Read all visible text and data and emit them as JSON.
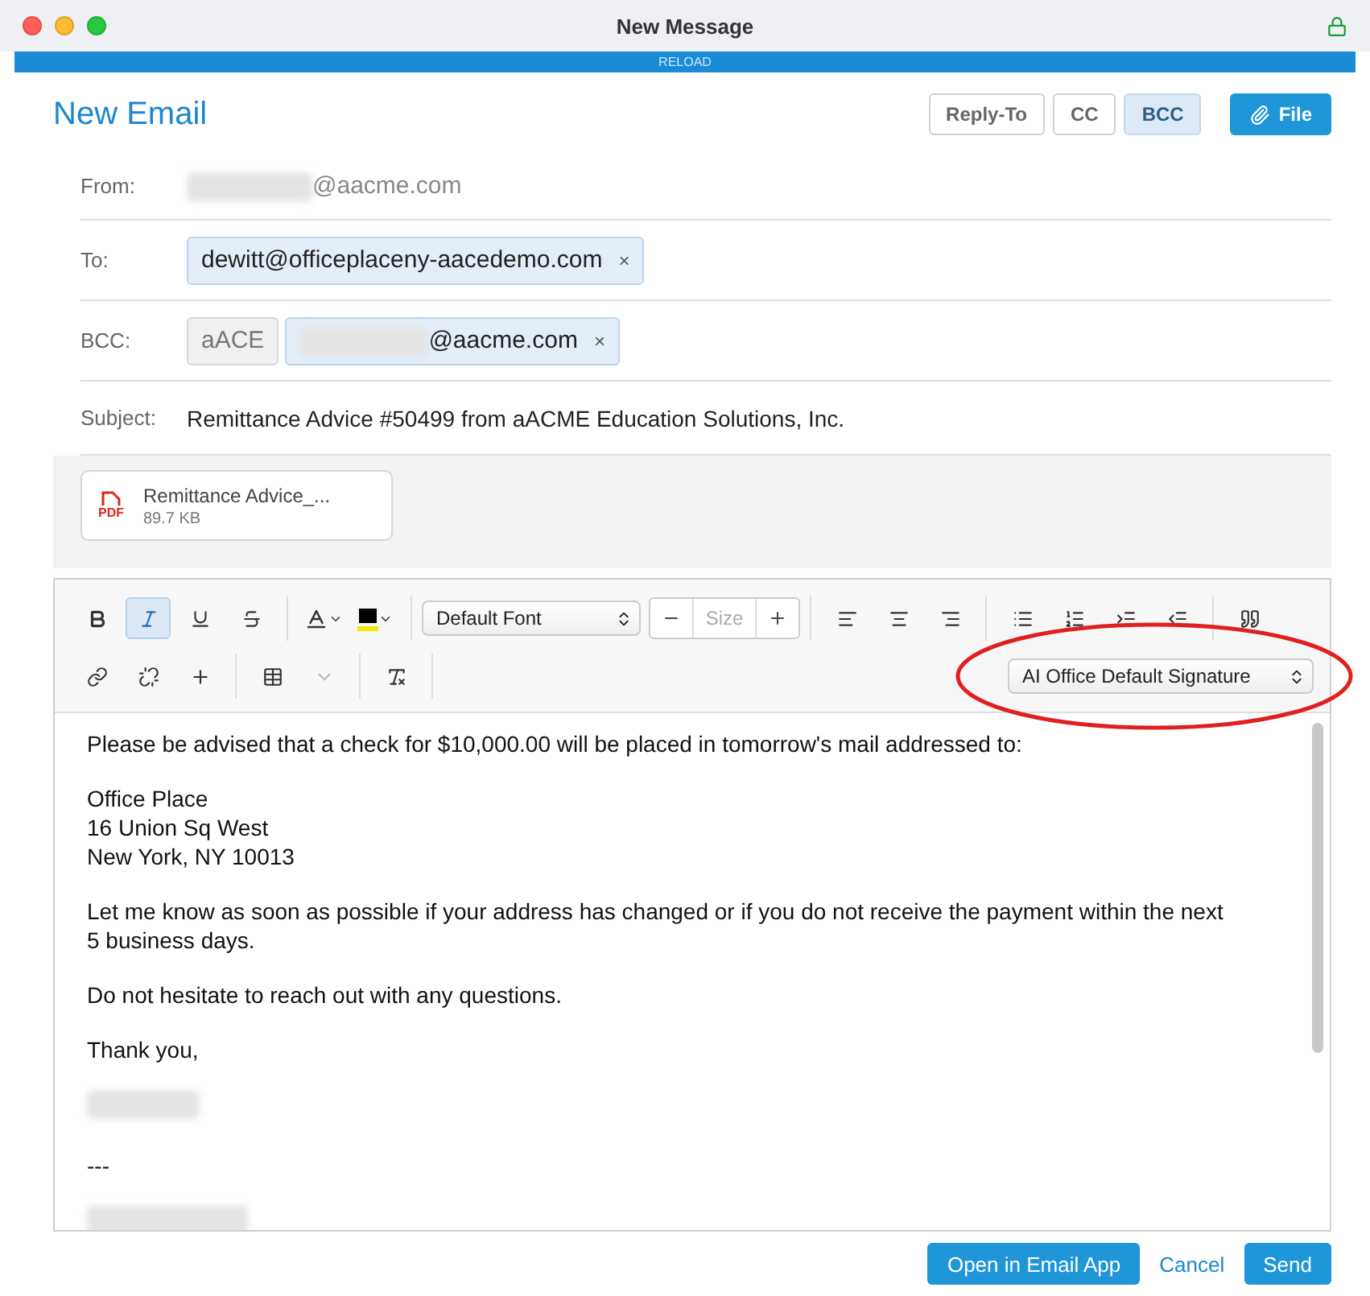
{
  "window": {
    "title": "New Message",
    "banner": "RELOAD"
  },
  "header": {
    "title": "New Email",
    "toggles": [
      {
        "label": "Reply-To",
        "selected": false
      },
      {
        "label": "CC",
        "selected": false
      },
      {
        "label": "BCC",
        "selected": true
      }
    ],
    "file_button": "File"
  },
  "fields": [
    {
      "label": "From:",
      "kind": "plain",
      "value": {
        "redacted_prefix": true,
        "text": "@aacme.com"
      }
    },
    {
      "label": "To:",
      "kind": "chips",
      "chips": [
        {
          "kind": "address",
          "redacted_prefix": false,
          "text": "dewitt@officeplaceny-aacedemo.com",
          "remove": "×"
        }
      ]
    },
    {
      "label": "BCC:",
      "kind": "chips",
      "chips": [
        {
          "kind": "tag",
          "text": "aACE"
        },
        {
          "kind": "address",
          "redacted_prefix": true,
          "text": "@aacme.com",
          "remove": "×"
        }
      ]
    },
    {
      "label": "Subject:",
      "kind": "text",
      "value": {
        "redacted_prefix": false,
        "text": "Remittance Advice #50499 from aACME Education Solutions, Inc."
      }
    }
  ],
  "attachments": [
    {
      "type_label": "PDF",
      "name": "Remittance Advice_...",
      "size": "89.7 KB"
    }
  ],
  "toolbar": {
    "rows": [
      [
        {
          "kind": "bold",
          "selected": false
        },
        {
          "kind": "italic",
          "selected": true
        },
        {
          "kind": "underline",
          "selected": false
        },
        {
          "kind": "strike",
          "selected": false
        },
        {
          "kind": "sep"
        },
        {
          "kind": "text-color"
        },
        {
          "kind": "highlight"
        },
        {
          "kind": "sep"
        },
        {
          "kind": "font-select",
          "value": "Default Font"
        },
        {
          "kind": "size",
          "placeholder": "Size"
        },
        {
          "kind": "sep"
        },
        {
          "kind": "align-left"
        },
        {
          "kind": "align-center"
        },
        {
          "kind": "align-right"
        },
        {
          "kind": "sep"
        },
        {
          "kind": "bullets"
        },
        {
          "kind": "numbers"
        },
        {
          "kind": "indent"
        },
        {
          "kind": "outdent"
        },
        {
          "kind": "sep"
        },
        {
          "kind": "quote"
        }
      ],
      [
        {
          "kind": "link"
        },
        {
          "kind": "unlink"
        },
        {
          "kind": "plus"
        },
        {
          "kind": "sep"
        },
        {
          "kind": "table"
        },
        {
          "kind": "caret",
          "disabled": true
        },
        {
          "kind": "sep"
        },
        {
          "kind": "clear-format"
        },
        {
          "kind": "sep"
        },
        {
          "kind": "spacer"
        },
        {
          "kind": "signature-select",
          "value": "AI Office Default Signature",
          "circled": true
        }
      ]
    ]
  },
  "body": [
    {
      "kind": "text",
      "text": "Please be advised that a check for $10,000.00 will be placed in tomorrow's mail addressed to:"
    },
    {
      "kind": "lines",
      "lines": [
        "Office Place",
        "16 Union Sq West",
        "New York, NY 10013"
      ]
    },
    {
      "kind": "text",
      "text": "Let me know as soon as possible if your address has changed or if you do not receive the payment within the next 5 business days."
    },
    {
      "kind": "text",
      "text": "Do not hesitate to reach out with any questions."
    },
    {
      "kind": "text",
      "text": "Thank you,"
    },
    {
      "kind": "redacted"
    },
    {
      "kind": "text",
      "text": "---"
    },
    {
      "kind": "redacted"
    }
  ],
  "footer": {
    "open_button": "Open in Email App",
    "cancel_link": "Cancel",
    "send_button": "Send"
  }
}
